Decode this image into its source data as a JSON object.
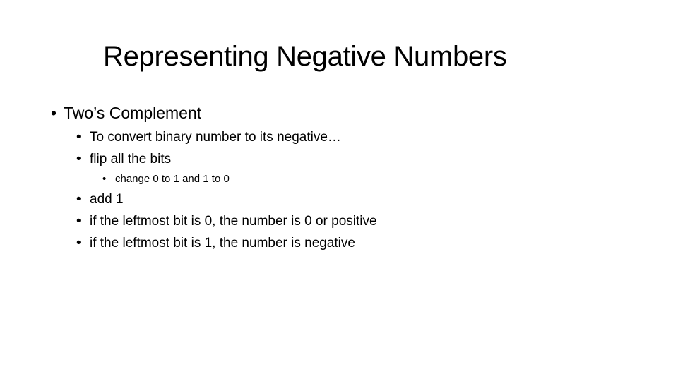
{
  "slide": {
    "title": "Representing Negative Numbers",
    "bullet_glyph": "•",
    "items": [
      {
        "level": 1,
        "text": "Two’s Complement"
      },
      {
        "level": 2,
        "text": "To convert binary number to its negative…"
      },
      {
        "level": 2,
        "text": "flip all the bits"
      },
      {
        "level": 3,
        "text": "change 0 to 1 and 1 to 0"
      },
      {
        "level": 2,
        "text": "add 1"
      },
      {
        "level": 2,
        "text": "if the leftmost bit is 0, the number is 0 or positive"
      },
      {
        "level": 2,
        "text": "if the leftmost bit is 1, the number is negative"
      }
    ]
  }
}
